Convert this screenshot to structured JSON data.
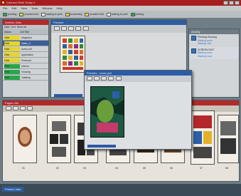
{
  "app": {
    "title": "Connect Work Today 3"
  },
  "menu": [
    "File",
    "Edit",
    "View",
    "Tools",
    "Window",
    "Help"
  ],
  "status_tabs": [
    {
      "label": "pending",
      "color": "#2aa54a"
    },
    {
      "label": "proofed hold",
      "color": "#d7d64a"
    },
    {
      "label": "waiting to print",
      "color": "#ffffff"
    },
    {
      "label": "processing",
      "color": "#e8d34a"
    },
    {
      "label": "proofed hold",
      "color": "#e8d34a"
    },
    {
      "label": "waiting to print",
      "color": "#ffffff"
    },
    {
      "label": "printing",
      "color": "#2aa54a"
    }
  ],
  "left_panel": {
    "title": "Archive Jobs",
    "toolbar": [
      "Date",
      "Sort",
      "Show all"
    ],
    "columns": [
      "Status",
      "Job Title"
    ],
    "rows": [
      {
        "status": "Hold",
        "title": "Magazine",
        "color": "#e5d52c"
      },
      {
        "status": "Hold",
        "title": "Sales_2",
        "color": "#e5d52c"
      },
      {
        "status": "Hold",
        "title": "Autos.sdf",
        "color": "#e5d52c"
      },
      {
        "status": "Hold",
        "title": "Application",
        "color": "#e5d52c"
      },
      {
        "status": "Hold",
        "title": "Postcard",
        "color": "#e5d52c"
      },
      {
        "status": "Print",
        "title": "Interior",
        "color": "#2aa54a"
      },
      {
        "status": "Print",
        "title": "Housing",
        "color": "#2aa54a"
      },
      {
        "status": "Print",
        "title": "Tabletop",
        "color": "#2aa54a"
      }
    ]
  },
  "center_panel": {
    "title": "Preview"
  },
  "preview_window": {
    "title": "Preview - cover.psd"
  },
  "activity_panel": {
    "title": "Activity",
    "items": [
      {
        "title": "Pending Housing",
        "sub1": "Starting soon",
        "sub2": "Starting Job"
      },
      {
        "title": "SCREEN EDIT",
        "sub1": "Starting soon",
        "sub2": "Starting soon"
      }
    ]
  },
  "pages_panel": {
    "title": "Pages Job",
    "page_labels": [
      "01",
      "02",
      "03",
      "04",
      "05",
      "06",
      "07",
      "08"
    ]
  },
  "bottom_bar": {
    "label": "Printed Jobs"
  }
}
